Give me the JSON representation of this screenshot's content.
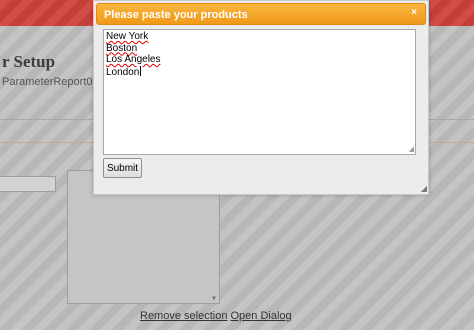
{
  "background": {
    "title": "r Setup",
    "subtitle": "ParameterReport01",
    "links": {
      "remove_selection": "Remove selection",
      "open_dialog": "Open Dialog"
    }
  },
  "dialog": {
    "title": "Please paste your products",
    "close_symbol": "×",
    "textarea_lines": [
      "New York",
      "Boston",
      "Los Angeles",
      "London"
    ],
    "submit_label": "Submit"
  },
  "colors": {
    "dialog_header": "#f5a623",
    "top_bar": "#c9463f"
  }
}
